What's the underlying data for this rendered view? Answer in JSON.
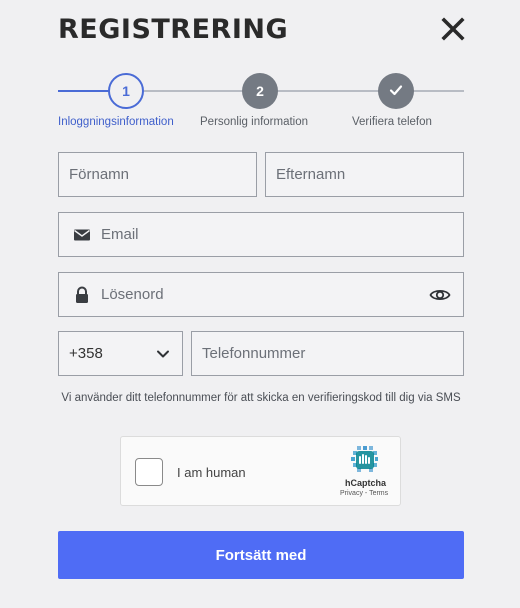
{
  "title": "REGISTRERING",
  "stepper": {
    "steps": [
      {
        "number": "1",
        "label": "Inloggningsinformation",
        "state": "active"
      },
      {
        "number": "2",
        "label": "Personlig information",
        "state": "pending"
      },
      {
        "number": "",
        "label": "Verifiera telefon",
        "state": "pending",
        "icon": "check-icon"
      }
    ]
  },
  "form": {
    "first_name_placeholder": "Förnamn",
    "last_name_placeholder": "Efternamn",
    "email_placeholder": "Email",
    "password_placeholder": "Lösenord",
    "country_code": "+358",
    "phone_placeholder": "Telefonnummer",
    "sms_note": "Vi använder ditt telefonnummer för att skicka en verifieringskod till dig via SMS"
  },
  "captcha": {
    "label": "I am human",
    "brand": "hCaptcha",
    "privacy": "Privacy",
    "separator": " - ",
    "terms": "Terms"
  },
  "actions": {
    "continue_label": "Fortsätt med"
  },
  "colors": {
    "accent": "#4f6cf5",
    "step_active": "#4a6bd6",
    "step_pending": "#747a83",
    "background": "#f0f0f2"
  }
}
